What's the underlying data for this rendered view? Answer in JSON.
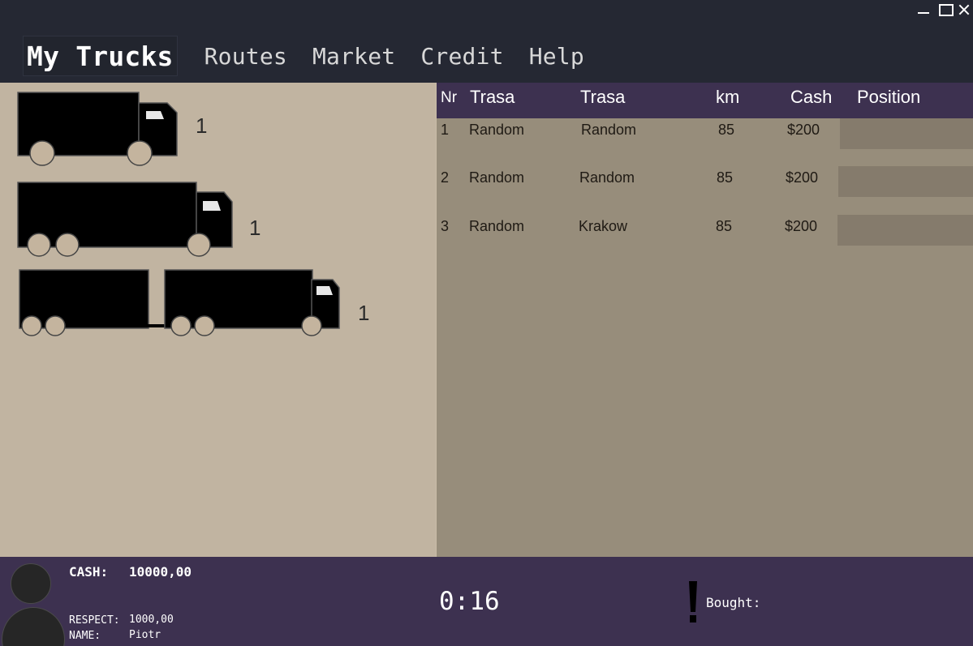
{
  "window": {
    "controls": [
      "minimize-icon",
      "maximize-icon",
      "close-icon"
    ]
  },
  "menu": {
    "items": [
      {
        "label": "My Trucks",
        "active": true
      },
      {
        "label": "Routes",
        "active": false
      },
      {
        "label": "Market",
        "active": false
      },
      {
        "label": "Credit",
        "active": false
      },
      {
        "label": "Help",
        "active": false
      }
    ]
  },
  "trucks": [
    {
      "type": "box truck",
      "icon": "box-truck-icon",
      "count": "1"
    },
    {
      "type": "long truck",
      "icon": "long-truck-icon",
      "count": "1"
    },
    {
      "type": "truck with trailer",
      "icon": "truck-trailer-icon",
      "count": "1"
    }
  ],
  "routes_table": {
    "headers": [
      "Nr",
      "Trasa",
      "Trasa",
      "km",
      "Cash",
      "Position"
    ],
    "rows": [
      {
        "nr": "1",
        "from": "Random",
        "to": "Random",
        "km": "85",
        "cash": "$200"
      },
      {
        "nr": "2",
        "from": "Random",
        "to": "Random",
        "km": "85",
        "cash": "$200"
      },
      {
        "nr": "3",
        "from": "Random",
        "to": "Krakow",
        "km": "85",
        "cash": "$200"
      }
    ]
  },
  "status": {
    "cash_label": "CASH:",
    "cash_value": "10000,00",
    "respect_label": "RESPECT:",
    "respect_value": "1000,00",
    "name_label": "NAME:",
    "name_value": "Piotr",
    "timer": "0:16",
    "bought_label": "Bought:"
  },
  "colors": {
    "menu_bg": "#252833",
    "left_panel": "#c1b4a1",
    "right_panel": "#978d7b",
    "header_bar": "#3d3150",
    "truck": "#000000",
    "wheel": "#c4b49e"
  }
}
